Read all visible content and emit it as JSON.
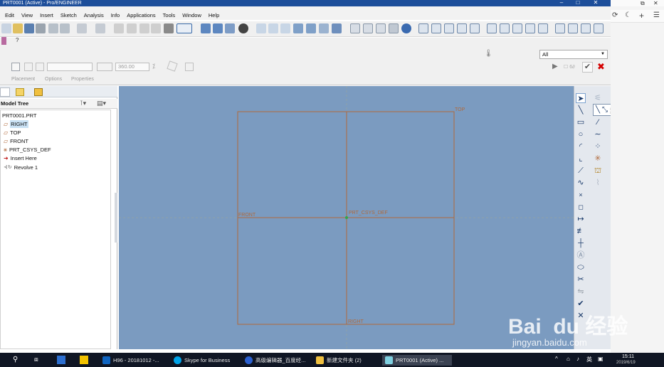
{
  "window": {
    "title": "PRT0001 (Active) - Pro/ENGINEER",
    "controls": [
      "–",
      "□",
      "✕"
    ]
  },
  "menubar": {
    "items": [
      "Edit",
      "View",
      "Insert",
      "Sketch",
      "Analysis",
      "Info",
      "Applications",
      "Tools",
      "Window",
      "Help"
    ]
  },
  "dashboard": {
    "angle_value": "360.00",
    "tabs": [
      "Placement",
      "Options",
      "Properties"
    ],
    "filter_value": "All"
  },
  "left_panel": {
    "header": "Model Tree",
    "items": [
      "PRT0001.PRT",
      "RIGHT",
      "TOP",
      "FRONT",
      "PRT_CSYS_DEF",
      "Insert Here",
      "Revolve 1"
    ]
  },
  "canvas": {
    "labels": {
      "top": "TOP",
      "front": "FRONT",
      "right": "RIGHT",
      "csys": "PRT_CSYS_DEF"
    },
    "colors": {
      "background": "#7b9bc0",
      "datum": "#b0693a"
    }
  },
  "watermark": {
    "brand": "Bai  du 经验",
    "url": "jingyan.baidu.com"
  },
  "taskbar": {
    "items": [
      "H96 - 20181012 -...",
      "Skype for Business",
      "高级编辑器_百度经...",
      "新建文件夹 (2)",
      "PRT0001 (Active) ..."
    ],
    "time": "15:11",
    "ime": "英",
    "date": "2019/6/19"
  }
}
